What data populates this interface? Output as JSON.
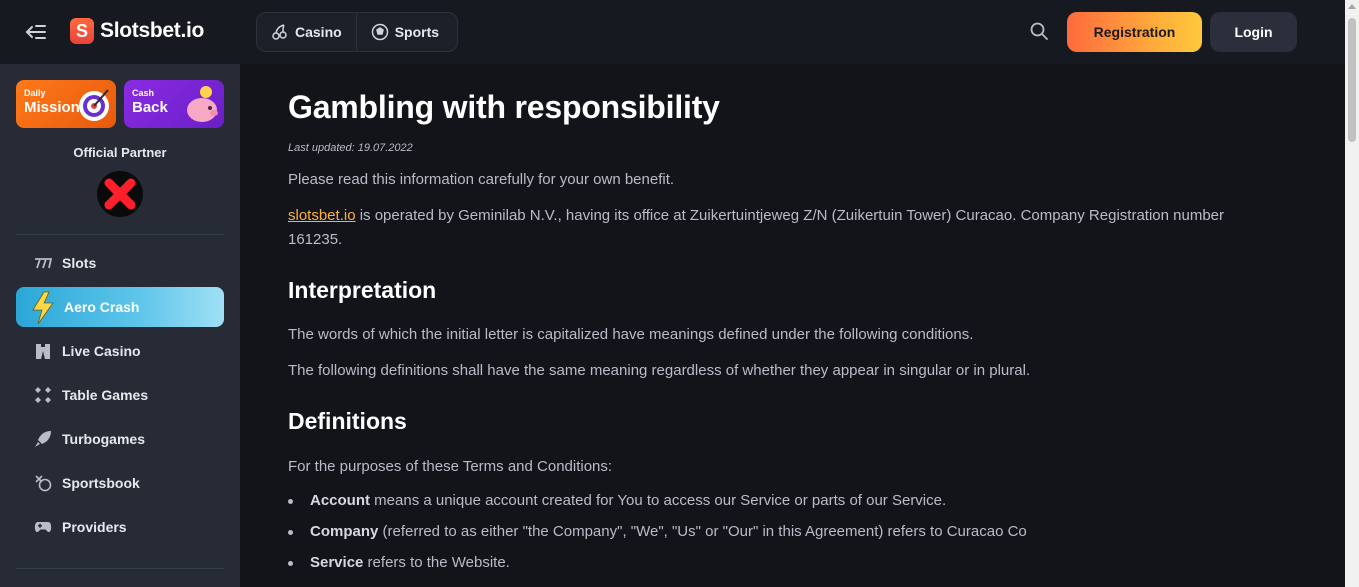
{
  "header": {
    "brand": "Slotsbet.io",
    "brand_mark": "S",
    "nav": [
      {
        "label": "Casino",
        "icon": "cherries-icon"
      },
      {
        "label": "Sports",
        "icon": "soccer-ball-icon"
      }
    ],
    "registration_label": "Registration",
    "login_label": "Login",
    "colors": {
      "accent_start": "#ff6a3d",
      "accent_end": "#ffc93c"
    }
  },
  "sidebar": {
    "promos": [
      {
        "small": "Daily",
        "big": "Mission",
        "icon": "target-icon"
      },
      {
        "small": "Cash",
        "big": "Back",
        "icon": "piggy-bank-icon"
      }
    ],
    "partner_label": "Official Partner",
    "partner_logo_icon": "broken-image-icon",
    "items": [
      {
        "label": "Slots",
        "icon": "slots-777-icon"
      },
      {
        "label": "Aero Crash",
        "icon": "lightning-icon"
      },
      {
        "label": "Live Casino",
        "icon": "dealer-icon"
      },
      {
        "label": "Table Games",
        "icon": "cards-icon"
      },
      {
        "label": "Turbogames",
        "icon": "rocket-icon"
      },
      {
        "label": "Sportsbook",
        "icon": "sportsbook-icon"
      },
      {
        "label": "Providers",
        "icon": "gamepad-icon"
      }
    ]
  },
  "main": {
    "title": "Gambling with responsibility",
    "updated": "Last updated: 19.07.2022",
    "intro": "Please read this information carefully for your own benefit.",
    "operator_link": "slotsbet.io",
    "operator_text": " is operated by Geminilab N.V., having its office at Zuikertuintjeweg Z/N (Zuikertuin Tower) Curacao. Company Registration number 161235.",
    "interpretation": {
      "heading": "Interpretation",
      "p1": "The words of which the initial letter is capitalized have meanings defined under the following conditions.",
      "p2": "The following definitions shall have the same meaning regardless of whether they appear in singular or in plural."
    },
    "definitions": {
      "heading": "Definitions",
      "intro": "For the purposes of these Terms and Conditions:",
      "items": [
        {
          "term": "Account",
          "text": " means a unique account created for You to access our Service or parts of our Service."
        },
        {
          "term": "Company",
          "text": " (referred to as either \"the Company\", \"We\", \"Us\" or \"Our\" in this Agreement) refers to Curacao Co"
        },
        {
          "term": "Service",
          "text": " refers to the Website."
        }
      ]
    }
  }
}
